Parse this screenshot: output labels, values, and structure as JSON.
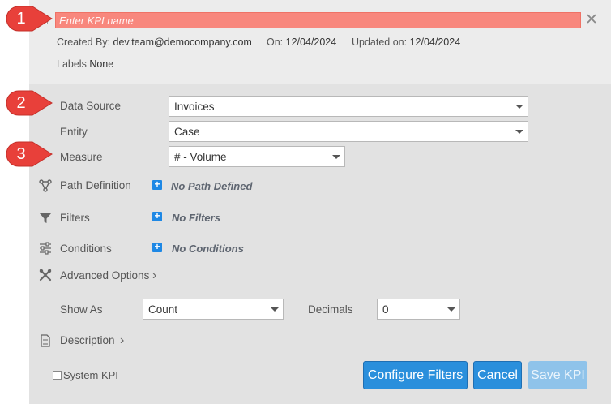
{
  "header": {
    "kpi_name_placeholder": "Enter KPI name",
    "created_by_label": "Created By:",
    "created_by_value": "dev.team@democompany.com",
    "on_label": "On:",
    "on_value": "12/04/2024",
    "updated_label": "Updated on:",
    "updated_value": "12/04/2024",
    "labels_label": "Labels",
    "labels_value": "None"
  },
  "callouts": [
    "1",
    "2",
    "3"
  ],
  "form": {
    "data_source_label": "Data Source",
    "data_source_value": "Invoices",
    "entity_label": "Entity",
    "entity_value": "Case",
    "measure_label": "Measure",
    "measure_value": "# - Volume",
    "path_definition_label": "Path Definition",
    "path_definition_empty": "No Path Defined",
    "filters_label": "Filters",
    "filters_empty": "No Filters",
    "conditions_label": "Conditions",
    "conditions_empty": "No Conditions",
    "advanced_options_label": "Advanced Options",
    "show_as_label": "Show As",
    "show_as_value": "Count",
    "decimals_label": "Decimals",
    "decimals_value": "0",
    "description_label": "Description"
  },
  "footer": {
    "system_kpi_label": "System KPI",
    "configure_filters_label": "Configure Filters",
    "cancel_label": "Cancel",
    "save_kpi_label": "Save KPI"
  },
  "colors": {
    "callout_red": "#e8403a",
    "name_input_bg": "#f8877d",
    "primary_button": "#2a8fdc",
    "disabled_button": "#8fc3ea",
    "plus_icon": "#1e88e5"
  }
}
